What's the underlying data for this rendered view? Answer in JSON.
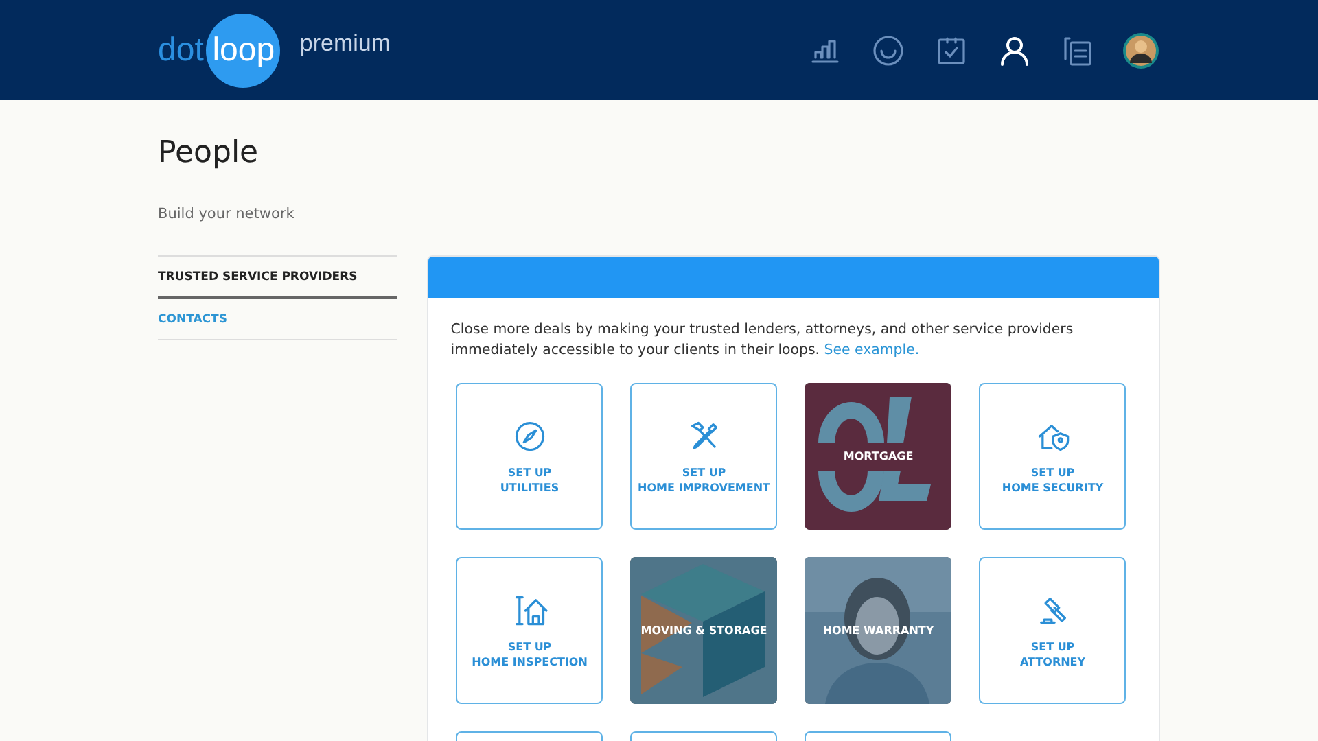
{
  "header": {
    "logo": {
      "left": "dot",
      "right": "loop"
    },
    "plan": "premium",
    "nav": [
      {
        "selected": false
      },
      {
        "selected": false
      },
      {
        "selected": false
      },
      {
        "selected": true
      },
      {
        "selected": false
      }
    ]
  },
  "page": {
    "title": "People",
    "subtitle": "Build your network"
  },
  "sidebar": {
    "items": [
      {
        "label": "TRUSTED SERVICE PROVIDERS",
        "selected": true
      },
      {
        "label": "CONTACTS",
        "selected": false
      }
    ]
  },
  "panel": {
    "intro": "Close more deals by making your trusted lenders, attorneys, and other service providers immediately accessible to your clients in their loops.",
    "link": "See example.",
    "tiles": [
      {
        "kind": "setup",
        "lines": [
          "SET UP",
          "UTILITIES"
        ]
      },
      {
        "kind": "setup",
        "lines": [
          "SET UP",
          "HOME IMPROVEMENT"
        ]
      },
      {
        "kind": "picture",
        "lines": [
          "MORTGAGE"
        ]
      },
      {
        "kind": "setup",
        "lines": [
          "SET UP",
          "HOME SECURITY"
        ]
      },
      {
        "kind": "setup",
        "lines": [
          "SET UP",
          "HOME INSPECTION"
        ]
      },
      {
        "kind": "picture",
        "lines": [
          "MOVING & STORAGE"
        ]
      },
      {
        "kind": "picture",
        "lines": [
          "HOME WARRANTY"
        ]
      },
      {
        "kind": "setup",
        "lines": [
          "SET UP",
          "ATTORNEY"
        ]
      },
      {
        "kind": "empty"
      },
      {
        "kind": "empty"
      },
      {
        "kind": "empty"
      }
    ]
  }
}
